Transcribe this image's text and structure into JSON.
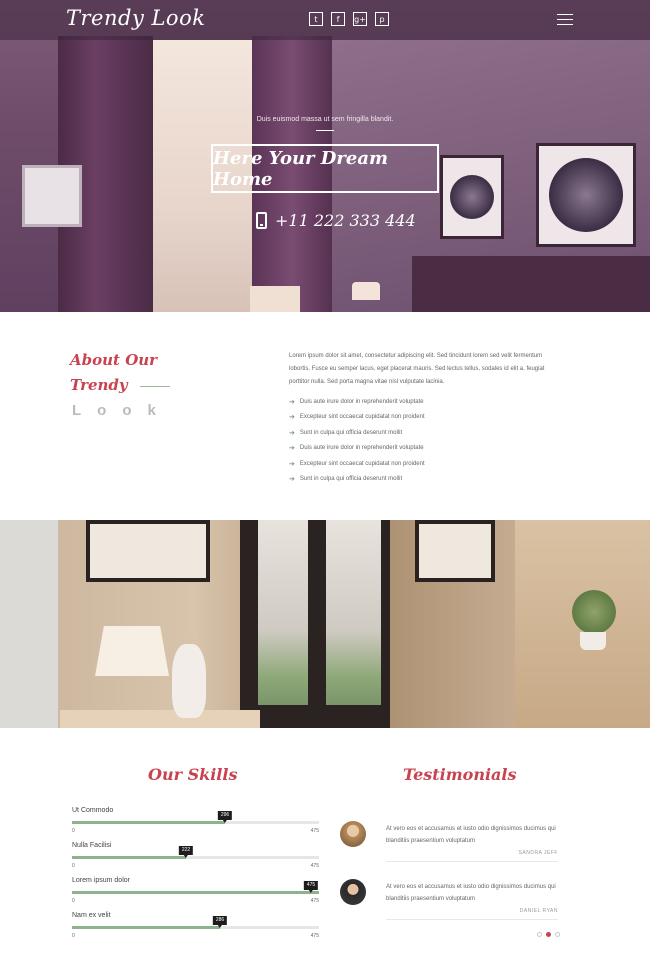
{
  "header": {
    "logo": "Trendy Look",
    "social": [
      {
        "icon": "twitter-icon",
        "glyph": "t"
      },
      {
        "icon": "facebook-icon",
        "glyph": "f"
      },
      {
        "icon": "google-plus-icon",
        "glyph": "g+"
      },
      {
        "icon": "pinterest-icon",
        "glyph": "p"
      }
    ],
    "menu_icon": "hamburger-menu-icon"
  },
  "hero": {
    "tagline": "Duis euismod massa ut sem fringilla blandit.",
    "title": "Here Your Dream Home",
    "phone": "+11 222 333 444"
  },
  "about": {
    "heading_line1": "About Our",
    "heading_line2": "Trendy",
    "heading_line3": "Look",
    "paragraph": "Lorem ipsum dolor sit amet, consectetur adipiscing elit. Sed tincidunt lorem sed velit fermentum lobortis. Fusce eu semper lacus, eget placerat mauris. Sed lectus tellus, sodales id elit a, feugiat porttitor nulla. Sed porta magna vitae nisl vulputate lacinia.",
    "list": [
      "Duis aute irure dolor in reprehenderit voluptate",
      "Excepteur sint occaecat cupidatat non proident",
      "Sunt in culpa qui officia deserunt mollit",
      "Duis aute irure dolor in reprehenderit voluptate",
      "Excepteur sint occaecat cupidatat non proident",
      "Sunt in culpa qui officia deserunt mollit"
    ]
  },
  "skills": {
    "title": "Our Skills",
    "items": [
      {
        "name": "Ut Commodo",
        "value": "296",
        "min": "0",
        "max": "475",
        "fraction": 0.62
      },
      {
        "name": "Nulla Facilisi",
        "value": "222",
        "min": "0",
        "max": "475",
        "fraction": 0.46
      },
      {
        "name": "Lorem ipsum dolor",
        "value": "475",
        "min": "0",
        "max": "475",
        "fraction": 1.0
      },
      {
        "name": "Nam ex velit",
        "value": "286",
        "min": "0",
        "max": "475",
        "fraction": 0.6
      }
    ]
  },
  "testimonials": {
    "title": "Testimonials",
    "items": [
      {
        "quote": "At vero eos et accusamus et iusto odio dignissimos ducimus qui blanditiis praesentium voluptatum",
        "author": "SANDRA JEFF"
      },
      {
        "quote": "At vero eos et accusamus et iusto odio dignissimos ducimus qui blanditiis praesentium voluptatum",
        "author": "DANIEL RYAN"
      }
    ],
    "active_dot": 2,
    "dot_count": 3
  },
  "colors": {
    "accent": "#c8434f",
    "skill_fill": "#8eb18e",
    "hero_overlay": "#6e4d6a"
  }
}
